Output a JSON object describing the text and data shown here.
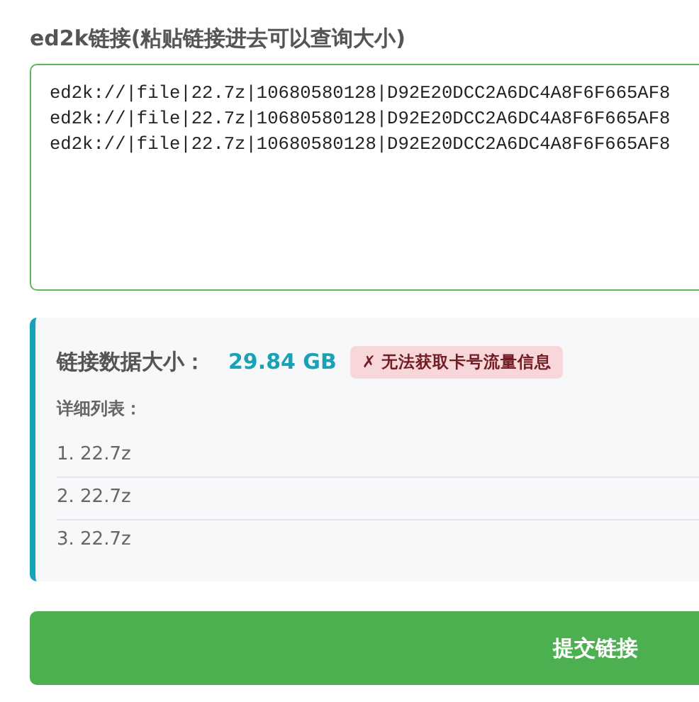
{
  "title": "ed2k链接(粘贴链接进去可以查询大小)",
  "link_field": {
    "value_lines": [
      "ed2k://|file|22.7z|10680580128|D92E20DCC2A6DC4A8F6F665AF8",
      "ed2k://|file|22.7z|10680580128|D92E20DCC2A6DC4A8F6F665AF8",
      "ed2k://|file|22.7z|10680580128|D92E20DCC2A6DC4A8F6F665AF8"
    ]
  },
  "result": {
    "size_label": "链接数据大小：",
    "size_value": "29.84 GB",
    "error_badge": "✗ 无法获取卡号流量信息",
    "detail_label": "详细列表：",
    "items": [
      "1. 22.7z",
      "2. 22.7z",
      "3. 22.7z"
    ]
  },
  "submit_button": "提交链接"
}
